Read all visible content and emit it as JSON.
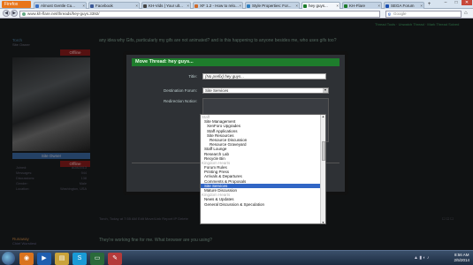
{
  "browser": {
    "menu_button": "Firefox",
    "tabs": [
      {
        "label": "Almost Gentle Cu...",
        "favicon_color": "#3b6fc2",
        "active": false
      },
      {
        "label": "Facebook",
        "favicon_color": "#3b5998",
        "active": false
      },
      {
        "label": "KH-Vids | Your ult...",
        "favicon_color": "#444444",
        "active": false
      },
      {
        "label": "XF 1.2 - How to relo...",
        "favicon_color": "#d06a2a",
        "active": false
      },
      {
        "label": "Style Properties: For...",
        "favicon_color": "#2f7fbf",
        "active": false
      },
      {
        "label": "hey guys... ",
        "favicon_color": "#1e7d2c",
        "active": true
      },
      {
        "label": "KH-Flare ",
        "favicon_color": "#1e7d2c",
        "active": false
      },
      {
        "label": "SEGA Forum",
        "favicon_color": "#1b4fb0",
        "active": false
      }
    ],
    "url": "www.kh-flare.net/threads/hey-guys.3392/",
    "search_placeholder": "Google",
    "window_controls": [
      "–",
      "□",
      "✕"
    ]
  },
  "forum": {
    "top_links": "Thread Tools  ·  Unwatch Thread  ·  Mark Thread Solved",
    "post": {
      "username": "Torch",
      "user_title": "Site Owner",
      "status": "Offline",
      "banner": "Site Owner",
      "status2": "Offline",
      "stats": [
        {
          "label": "Joined:",
          "value": "8/28/2013"
        },
        {
          "label": "Messages:",
          "value": "944"
        },
        {
          "label": "Discussions:",
          "value": "138"
        },
        {
          "label": "Gender:",
          "value": "Male"
        },
        {
          "label": "Location:",
          "value": "Washington, USA"
        }
      ],
      "text": "any idea why Gifs, particularly my gifs are not animated? and is this happening to anyone besides me, who uses gifs too?",
      "meta": "Torch, Today at 7:55 AM   Edit   Move/Link   Report   IP   Delete"
    },
    "reply": {
      "username": "Runaway",
      "user_title": "Chief Worstiest",
      "text": "They're working fine for me. What browser are you using?"
    }
  },
  "modal": {
    "title": "Move Thread: hey guys...",
    "title_label": "Title:",
    "title_value": "(No prefix)   hey guys...",
    "destination_label": "Destination Forum:",
    "destination_value": "Site Services",
    "redirect_label": "Redirection Notice:",
    "dropdown_items": [
      {
        "label": "Staff",
        "level": 0,
        "group": true
      },
      {
        "label": "Site Management",
        "level": 1
      },
      {
        "label": "XenForo Upgrades",
        "level": 2
      },
      {
        "label": "Staff Applications",
        "level": 2
      },
      {
        "label": "Site Resources",
        "level": 2
      },
      {
        "label": "Resource Discussion",
        "level": 3
      },
      {
        "label": "Resource Graveyard",
        "level": 3
      },
      {
        "label": "Staff Lounge",
        "level": 1
      },
      {
        "label": "Research Lab",
        "level": 1
      },
      {
        "label": "Recycle Bin",
        "level": 1
      },
      {
        "label": "Kingdom Hearts",
        "level": 0,
        "group": true
      },
      {
        "label": "Forum Rules",
        "level": 1
      },
      {
        "label": "Printing Press",
        "level": 1
      },
      {
        "label": "Arrivals & Departures",
        "level": 1
      },
      {
        "label": "Comments & Proposals",
        "level": 1
      },
      {
        "label": "Site Services",
        "level": 1,
        "selected": true
      },
      {
        "label": "Mature Discussion",
        "level": 1
      },
      {
        "label": "Kingdom Hearts",
        "level": 0,
        "group": true
      },
      {
        "label": "News & Updates",
        "level": 1
      },
      {
        "label": "General Discussion & Speculation",
        "level": 1
      }
    ]
  },
  "taskbar": {
    "apps": [
      {
        "name": "firefox-icon",
        "glyph": "◉",
        "color": "#d9731e"
      },
      {
        "name": "media-player-icon",
        "glyph": "▶",
        "color": "#1f5fb0"
      },
      {
        "name": "folder-icon",
        "glyph": "▤",
        "color": "#c9a23a"
      },
      {
        "name": "skype-icon",
        "glyph": "S",
        "color": "#1a9ad6"
      },
      {
        "name": "tablet-icon",
        "glyph": "▭",
        "color": "#2a6a3a"
      },
      {
        "name": "paint-icon",
        "glyph": "✎",
        "color": "#b43b3b"
      }
    ],
    "time": "8:56 AM",
    "date": "2/5/2014"
  }
}
